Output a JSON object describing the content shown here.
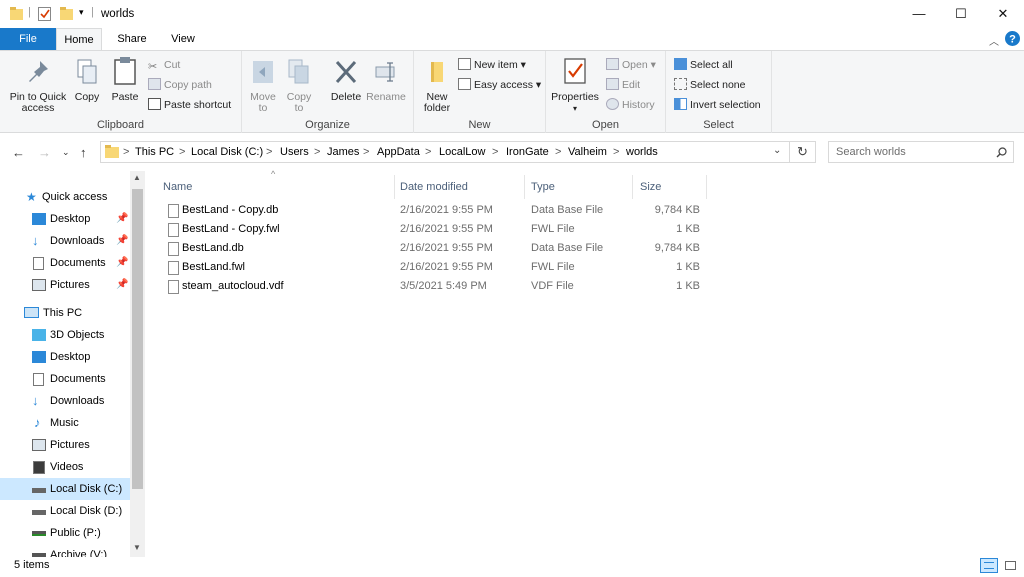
{
  "window": {
    "title": "worlds",
    "quick_access_toolbar_dropdown": "▾",
    "controls": {
      "minimize": "—",
      "maximize": "☐",
      "close": "✕"
    }
  },
  "ribbon_tabs": [
    {
      "label": "File"
    },
    {
      "label": "Home"
    },
    {
      "label": "Share"
    },
    {
      "label": "View"
    }
  ],
  "ribbon": {
    "clipboard": {
      "label": "Clipboard",
      "pin_quick_access_line1": "Pin to Quick",
      "pin_quick_access_line2": "access",
      "copy": "Copy",
      "paste": "Paste",
      "cut": "Cut",
      "copy_path": "Copy path",
      "paste_shortcut": "Paste shortcut"
    },
    "organize": {
      "label": "Organize",
      "move_to_line1": "Move",
      "move_to_line2": "to",
      "copy_to_line1": "Copy",
      "copy_to_line2": "to",
      "delete": "Delete",
      "rename": "Rename"
    },
    "new": {
      "label": "New",
      "new_folder_line1": "New",
      "new_folder_line2": "folder",
      "new_item": "New item",
      "easy_access": "Easy access"
    },
    "open": {
      "label": "Open",
      "properties": "Properties",
      "open": "Open",
      "edit": "Edit",
      "history": "History"
    },
    "select": {
      "label": "Select",
      "select_all": "Select all",
      "select_none": "Select none",
      "invert_selection": "Invert selection"
    }
  },
  "address": {
    "crumbs": [
      "This PC",
      "Local Disk (C:)",
      "Users",
      "James",
      "AppData",
      "LocalLow",
      "IronGate",
      "Valheim",
      "worlds"
    ],
    "separator": ">"
  },
  "search": {
    "placeholder": "Search worlds"
  },
  "nav": {
    "quick_access": "Quick access",
    "pinned": [
      {
        "label": "Desktop"
      },
      {
        "label": "Downloads"
      },
      {
        "label": "Documents"
      },
      {
        "label": "Pictures"
      }
    ],
    "this_pc": "This PC",
    "pc_items": [
      {
        "label": "3D Objects"
      },
      {
        "label": "Desktop"
      },
      {
        "label": "Documents"
      },
      {
        "label": "Downloads"
      },
      {
        "label": "Music"
      },
      {
        "label": "Pictures"
      },
      {
        "label": "Videos"
      },
      {
        "label": "Local Disk (C:)"
      },
      {
        "label": "Local Disk (D:)"
      },
      {
        "label": "Public (P:)"
      },
      {
        "label": "Archive (V:)"
      }
    ]
  },
  "columns": {
    "name": "Name",
    "date": "Date modified",
    "type": "Type",
    "size": "Size"
  },
  "files": [
    {
      "name": "BestLand - Copy.db",
      "date": "2/16/2021 9:55 PM",
      "type": "Data Base File",
      "size": "9,784 KB"
    },
    {
      "name": "BestLand - Copy.fwl",
      "date": "2/16/2021 9:55 PM",
      "type": "FWL File",
      "size": "1 KB"
    },
    {
      "name": "BestLand.db",
      "date": "2/16/2021 9:55 PM",
      "type": "Data Base File",
      "size": "9,784 KB"
    },
    {
      "name": "BestLand.fwl",
      "date": "2/16/2021 9:55 PM",
      "type": "FWL File",
      "size": "1 KB"
    },
    {
      "name": "steam_autocloud.vdf",
      "date": "3/5/2021 5:49 PM",
      "type": "VDF File",
      "size": "1 KB"
    }
  ],
  "status": {
    "count": "5 items"
  },
  "colors": {
    "accent": "#1979ca",
    "selection": "#cce8ff",
    "folder": "#f8d775",
    "header_text": "#4c607a"
  }
}
